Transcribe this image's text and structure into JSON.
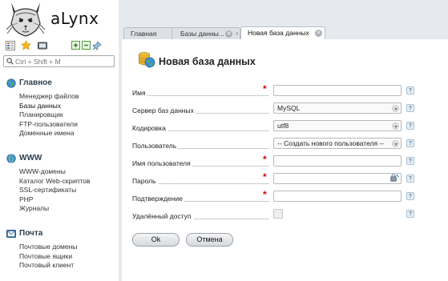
{
  "app": {
    "name": "aLynx"
  },
  "search": {
    "placeholder": "Ctrl + Shift + M"
  },
  "sidebar": {
    "sections": [
      {
        "title": "Главное",
        "items": [
          "Менеджер файлов",
          "Базы данных",
          "Планировщик",
          "FTP-пользователи",
          "Доменные имена"
        ]
      },
      {
        "title": "WWW",
        "items": [
          "WWW-домены",
          "Каталог Web-скриптов",
          "SSL-сертификаты",
          "PHP",
          "Журналы"
        ]
      },
      {
        "title": "Почта",
        "items": [
          "Почтовые домены",
          "Почтовые ящики",
          "Почтовый клиент"
        ]
      }
    ]
  },
  "tabs": [
    {
      "label": "Главная"
    },
    {
      "label": "Базы данны..."
    },
    {
      "label": "Новая база данных"
    }
  ],
  "form": {
    "title": "Новая база данных",
    "fields": {
      "name": {
        "label": "Имя",
        "value": ""
      },
      "server": {
        "label": "Сервер баз данных",
        "value": "MySQL"
      },
      "encoding": {
        "label": "Кодировка",
        "value": "utf8"
      },
      "user": {
        "label": "Пользователь",
        "value": "-- Создать нового пользователя --"
      },
      "username": {
        "label": "Имя пользователя",
        "value": ""
      },
      "password": {
        "label": "Пароль",
        "value": ""
      },
      "confirm": {
        "label": "Подтверждение",
        "value": ""
      },
      "remote": {
        "label": "Удалённый доступ",
        "checked": false
      }
    },
    "required_mark": "*",
    "help_mark": "?",
    "ok_label": "Ok",
    "cancel_label": "Отмена"
  },
  "colors": {
    "panel_bg": "#e6e9ee",
    "required": "#dd0000",
    "section_title": "#2a3e4e"
  }
}
